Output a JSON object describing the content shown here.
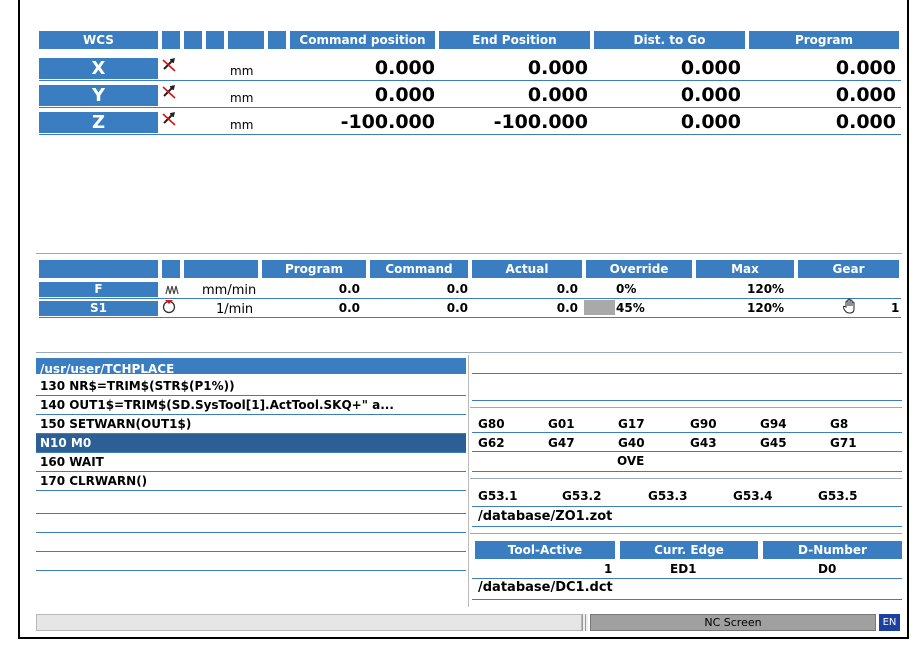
{
  "colors": {
    "accent": "#3a7dc0",
    "selected": "#2c5f94",
    "status_gray": "#a0a0a0"
  },
  "axes_table": {
    "headers": {
      "wcs": "WCS",
      "command": "Command position",
      "end": "End Position",
      "dist": "Dist. to Go",
      "program": "Program"
    },
    "rows": [
      {
        "name": "X",
        "unit": "mm",
        "command": "0.000",
        "end": "0.000",
        "dist": "0.000",
        "program": "0.000",
        "icon": "axis-disabled-icon"
      },
      {
        "name": "Y",
        "unit": "mm",
        "command": "0.000",
        "end": "0.000",
        "dist": "0.000",
        "program": "0.000",
        "icon": "axis-disabled-icon"
      },
      {
        "name": "Z",
        "unit": "mm",
        "command": "-100.000",
        "end": "-100.000",
        "dist": "0.000",
        "program": "0.000",
        "icon": "axis-disabled-icon"
      }
    ]
  },
  "spindle_table": {
    "headers": {
      "program": "Program",
      "command": "Command",
      "actual": "Actual",
      "override": "Override",
      "max": "Max",
      "gear": "Gear"
    },
    "rows": [
      {
        "name": "F",
        "unit": "mm/min",
        "program": "0.0",
        "command": "0.0",
        "actual": "0.0",
        "override": "0%",
        "max": "120%",
        "gear": ""
      },
      {
        "name": "S1",
        "unit": "1/min",
        "program": "0.0",
        "command": "0.0",
        "actual": "0.0",
        "override": "45%",
        "max": "120%",
        "gear": "1"
      }
    ],
    "s1_override_fraction": 0.45
  },
  "program": {
    "path": "/usr/user/TCHPLACE",
    "lines": [
      "130 NR$=TRIM$(STR$(P1%))",
      "140 OUT1$=TRIM$(SD.SysTool[1].ActTool.SKQ+\" a...",
      "150 SETWARN(OUT1$)",
      "N10 M0",
      "160 WAIT",
      "170 CLRWARN()"
    ],
    "selected_index": 3
  },
  "gcodes": {
    "row1": [
      "G80",
      "G01",
      "G17",
      "G90",
      "G94",
      "G8"
    ],
    "row2": [
      "G62",
      "G47",
      "G40",
      "G43",
      "G45",
      "G71"
    ],
    "ove": "OVE",
    "zero_offsets": [
      "G53.1",
      "G53.2",
      "G53.3",
      "G53.4",
      "G53.5"
    ],
    "zo_file": "/database/ZO1.zot"
  },
  "tool": {
    "headers": {
      "active": "Tool-Active",
      "edge": "Curr. Edge",
      "dnum": "D-Number"
    },
    "active": "1",
    "edge": "ED1",
    "dnum": "D0",
    "file": "/database/DC1.dct"
  },
  "status": {
    "screen": "NC Screen",
    "lang": "EN"
  }
}
